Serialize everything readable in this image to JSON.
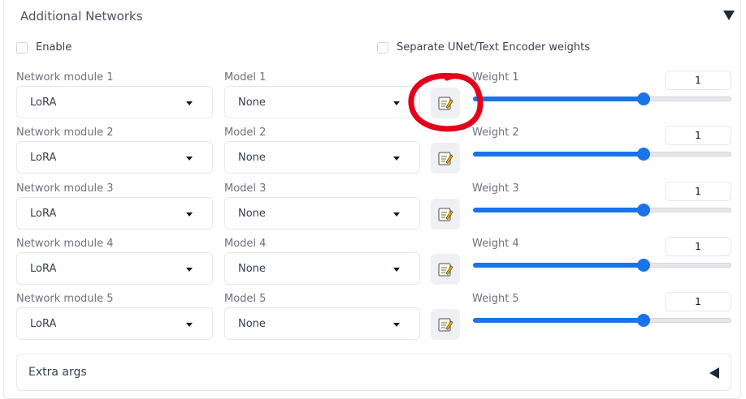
{
  "accordion": {
    "title": "Additional Networks"
  },
  "options": {
    "enable_label": "Enable",
    "separate_label": "Separate UNet/Text Encoder weights"
  },
  "rows": [
    {
      "module_label": "Network module 1",
      "module_value": "LoRA",
      "model_label": "Model 1",
      "model_value": "None",
      "weight_label": "Weight 1",
      "weight_value": "1",
      "weight_fraction": 0.66
    },
    {
      "module_label": "Network module 2",
      "module_value": "LoRA",
      "model_label": "Model 2",
      "model_value": "None",
      "weight_label": "Weight 2",
      "weight_value": "1",
      "weight_fraction": 0.66
    },
    {
      "module_label": "Network module 3",
      "module_value": "LoRA",
      "model_label": "Model 3",
      "model_value": "None",
      "weight_label": "Weight 3",
      "weight_value": "1",
      "weight_fraction": 0.66
    },
    {
      "module_label": "Network module 4",
      "module_value": "LoRA",
      "model_label": "Model 4",
      "model_value": "None",
      "weight_label": "Weight 4",
      "weight_value": "1",
      "weight_fraction": 0.66
    },
    {
      "module_label": "Network module 5",
      "module_value": "LoRA",
      "model_label": "Model 5",
      "model_value": "None",
      "weight_label": "Weight 5",
      "weight_value": "1",
      "weight_fraction": 0.66
    }
  ],
  "extra_args": {
    "label": "Extra args"
  },
  "colors": {
    "accent": "#1a73e8",
    "annotation": "#e3001b"
  },
  "icons": {
    "edit": "notepad-pencil-icon",
    "collapse": "triangle-down-icon",
    "expand": "triangle-left-icon"
  }
}
